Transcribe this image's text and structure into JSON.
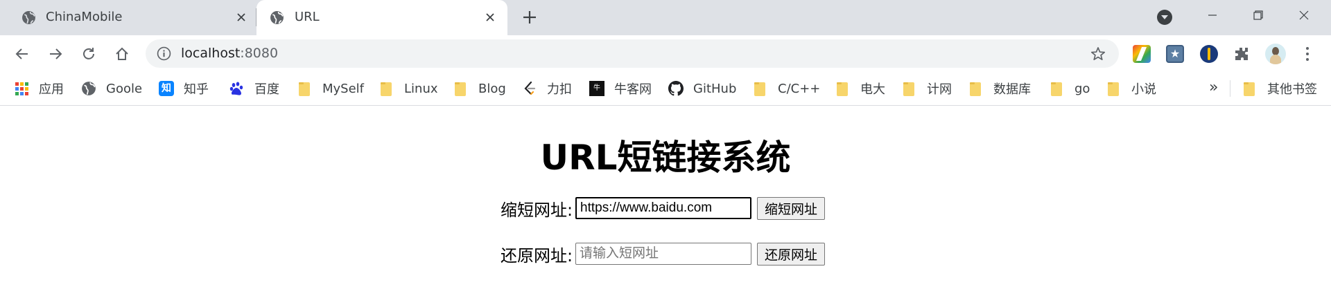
{
  "tabs": [
    {
      "title": "ChinaMobile",
      "active": false
    },
    {
      "title": "URL",
      "active": true
    }
  ],
  "address_bar": {
    "host": "localhost",
    "port": ":8080"
  },
  "bookmarks": {
    "items": [
      {
        "label": "应用",
        "icon": "apps-grid-icon"
      },
      {
        "label": "Goole",
        "icon": "globe-icon"
      },
      {
        "label": "知乎",
        "icon": "zhihu-icon",
        "glyph": "知"
      },
      {
        "label": "百度",
        "icon": "baidu-paw-icon"
      },
      {
        "label": "MySelf",
        "icon": "folder-icon"
      },
      {
        "label": "Linux",
        "icon": "folder-icon"
      },
      {
        "label": "Blog",
        "icon": "folder-icon"
      },
      {
        "label": "力扣",
        "icon": "leetcode-icon"
      },
      {
        "label": "牛客网",
        "icon": "nowcoder-icon",
        "glyph": "牛"
      },
      {
        "label": "GitHub",
        "icon": "github-icon"
      },
      {
        "label": "C/C++",
        "icon": "folder-icon"
      },
      {
        "label": "电大",
        "icon": "folder-icon"
      },
      {
        "label": "计网",
        "icon": "folder-icon"
      },
      {
        "label": "数据库",
        "icon": "folder-icon"
      },
      {
        "label": "go",
        "icon": "folder-icon"
      },
      {
        "label": "小说",
        "icon": "folder-icon"
      }
    ],
    "overflow": "»",
    "other": "其他书签"
  },
  "page": {
    "title": "URL短链接系统",
    "shorten": {
      "label": "缩短网址:",
      "value": "https://www.baidu.com",
      "button": "缩短网址"
    },
    "restore": {
      "label": "还原网址:",
      "placeholder": "请输入短网址",
      "button": "还原网址"
    }
  },
  "colors": {
    "tabstrip": "#dee1e6",
    "omnibox": "#f1f3f4",
    "folder": "#f7d56b",
    "apps_grid": [
      "#ea4335",
      "#fbbc05",
      "#34a853",
      "#4285f4",
      "#ea4335",
      "#fbbc05",
      "#34a853",
      "#4285f4",
      "#ea4335"
    ]
  }
}
